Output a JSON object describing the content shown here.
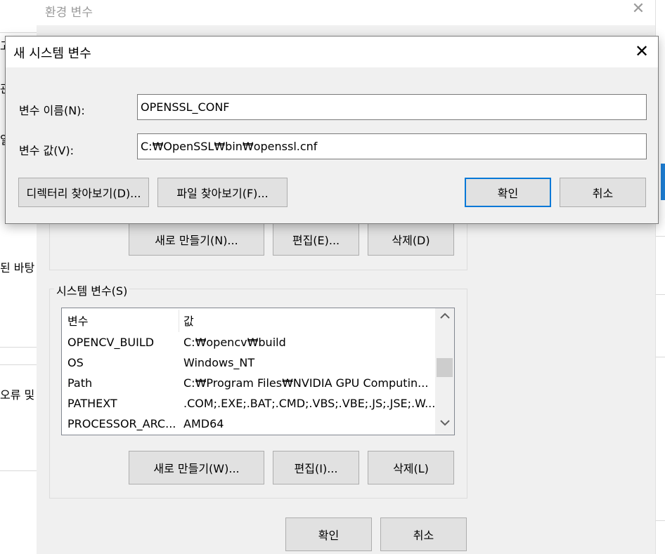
{
  "background_window": {
    "fragments": [
      "고",
      "관",
      "일",
      "된 바탕",
      "오류 및"
    ]
  },
  "env_dialog": {
    "title": "환경 변수",
    "close_glyph": "✕",
    "user_buttons": {
      "new": "새로 만들기(N)...",
      "edit": "편집(E)...",
      "delete": "삭제(D)"
    },
    "system_group_label": "시스템 변수(S)",
    "system_table": {
      "headers": [
        "변수",
        "값"
      ],
      "rows": [
        [
          "OPENCV_BUILD",
          "C:₩opencv₩build"
        ],
        [
          "OS",
          "Windows_NT"
        ],
        [
          "Path",
          "C:₩Program Files₩NVIDIA GPU Computin..."
        ],
        [
          "PATHEXT",
          ".COM;.EXE;.BAT;.CMD;.VBS;.VBE;.JS;.JSE;.W..."
        ],
        [
          "PROCESSOR_ARC...",
          "AMD64"
        ]
      ]
    },
    "system_buttons": {
      "new": "새로 만들기(W)...",
      "edit": "편집(I)...",
      "delete": "삭제(L)"
    },
    "ok": "확인",
    "cancel": "취소"
  },
  "new_var_dialog": {
    "title": "새 시스템 변수",
    "close_glyph": "✕",
    "name_label": "변수 이름(N):",
    "name_value": "OPENSSL_CONF",
    "value_label": "변수 값(V):",
    "value_value": "C:₩OpenSSL₩bin₩openssl.cnf",
    "browse_dir": "디렉터리 찾아보기(D)...",
    "browse_file": "파일 찾아보기(F)...",
    "ok": "확인",
    "cancel": "취소"
  },
  "icons": {
    "close": "close-icon",
    "scroll_up": "chevron-up-icon",
    "scroll_down": "chevron-down-icon"
  },
  "colors": {
    "accent": "#0078d7",
    "dialog_bg": "#f0f0f0",
    "button_bg": "#e1e1e1"
  }
}
